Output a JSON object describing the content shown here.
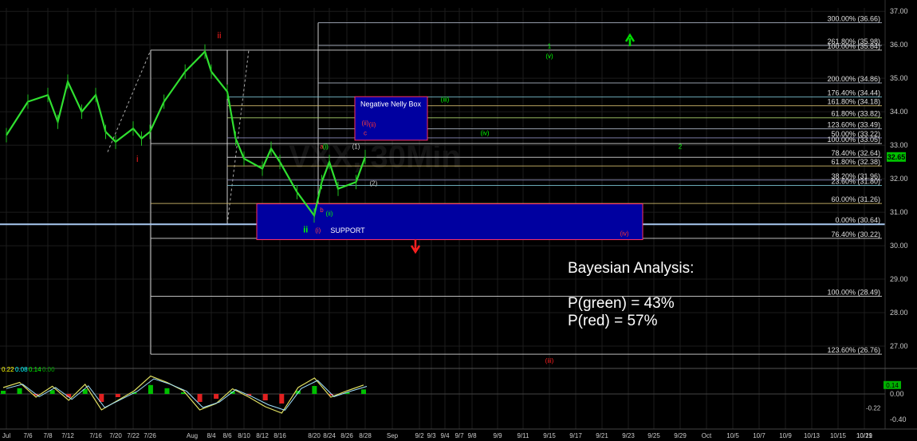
{
  "chart_data": {
    "type": "line",
    "price_axis": {
      "ticks": [
        "37.00",
        "36.00",
        "35.00",
        "34.00",
        "33.00",
        "32.00",
        "31.00",
        "30.00",
        "29.00",
        "28.00",
        "27.00"
      ],
      "current_price": "32.65",
      "ylim": [
        26.5,
        37.1
      ]
    },
    "osc_axis": {
      "ticks": [
        "0.00",
        "-0.40"
      ],
      "badges": [
        "0.14",
        "-0.22"
      ],
      "ylim": [
        -0.55,
        0.4
      ],
      "header": [
        {
          "text": "0.22",
          "color": "#ffff00"
        },
        {
          "text": "0.08",
          "color": "#00ffff"
        },
        {
          "text": "0.14",
          "color": "#00ff00"
        },
        {
          "text": "0.00",
          "color": "#00a000"
        }
      ]
    },
    "x_ticks": [
      "Jul",
      "7/6",
      "7/8",
      "7/12",
      "7/16",
      "7/20",
      "7/22",
      "7/26",
      "Aug",
      "8/4",
      "8/6",
      "8/10",
      "8/12",
      "8/16",
      "8/20",
      "8/24",
      "8/26",
      "8/28",
      "Sep",
      "9/2",
      "9/3",
      "9/4",
      "9/7",
      "9/8",
      "9/9",
      "9/11",
      "9/15",
      "9/17",
      "9/21",
      "9/23",
      "9/25",
      "9/29",
      "Oct",
      "10/5",
      "10/7",
      "10/9",
      "10/13",
      "10/15",
      "10/19",
      "10/21"
    ],
    "price_series": [
      {
        "date": "7/1",
        "price": 33.3
      },
      {
        "date": "7/6",
        "price": 34.3
      },
      {
        "date": "7/8",
        "price": 34.5
      },
      {
        "date": "7/10",
        "price": 33.7
      },
      {
        "date": "7/12",
        "price": 34.9
      },
      {
        "date": "7/14",
        "price": 34.0
      },
      {
        "date": "7/16",
        "price": 34.5
      },
      {
        "date": "7/18",
        "price": 33.4
      },
      {
        "date": "7/20",
        "price": 33.1
      },
      {
        "date": "7/22",
        "price": 33.5
      },
      {
        "date": "7/24",
        "price": 33.2
      },
      {
        "date": "7/26",
        "price": 33.4
      },
      {
        "date": "7/28",
        "price": 34.3
      },
      {
        "date": "7/31",
        "price": 35.2
      },
      {
        "date": "8/3",
        "price": 35.8
      },
      {
        "date": "8/4",
        "price": 35.2
      },
      {
        "date": "8/6",
        "price": 34.6
      },
      {
        "date": "8/8",
        "price": 33.2
      },
      {
        "date": "8/10",
        "price": 32.6
      },
      {
        "date": "8/12",
        "price": 32.3
      },
      {
        "date": "8/14",
        "price": 32.9
      },
      {
        "date": "8/16",
        "price": 32.5
      },
      {
        "date": "8/18",
        "price": 31.6
      },
      {
        "date": "8/20",
        "price": 30.9
      },
      {
        "date": "8/22",
        "price": 31.9
      },
      {
        "date": "8/24",
        "price": 32.5
      },
      {
        "date": "8/25",
        "price": 31.7
      },
      {
        "date": "8/27",
        "price": 31.9
      },
      {
        "date": "8/28",
        "price": 32.65
      }
    ],
    "fib_levels": [
      {
        "label": "300.00% (36.66)",
        "price": 36.66,
        "color": "#b0b8c8"
      },
      {
        "label": "261.80% (35.98)",
        "price": 35.98,
        "color": "#b0b8c8"
      },
      {
        "label": "100.00% (35.84)",
        "price": 35.84,
        "color": "#dddddd"
      },
      {
        "label": "200.00% (34.86)",
        "price": 34.86,
        "color": "#b0b8c8"
      },
      {
        "label": "176.40% (34.44)",
        "price": 34.44,
        "color": "#7ec8d8"
      },
      {
        "label": "161.80% (34.18)",
        "price": 34.18,
        "color": "#d8c070"
      },
      {
        "label": "61.80% (33.82)",
        "price": 33.82,
        "color": "#b0d870"
      },
      {
        "label": "123.60% (33.49)",
        "price": 33.49,
        "color": "#b0b8c8"
      },
      {
        "label": "50.00% (33.22)",
        "price": 33.22,
        "color": "#9090c0"
      },
      {
        "label": "100.00% (33.05)",
        "price": 33.05,
        "color": "#dddddd"
      },
      {
        "label": "78.40% (32.64)",
        "price": 32.64,
        "color": "#dddddd"
      },
      {
        "label": "61.80% (32.38)",
        "price": 32.38,
        "color": "#d8c070"
      },
      {
        "label": "38.20% (31.96)",
        "price": 31.96,
        "color": "#9090c0"
      },
      {
        "label": "23.60% (31.80)",
        "price": 31.8,
        "color": "#7ec8d8"
      },
      {
        "label": "60.00% (31.26)",
        "price": 31.26,
        "color": "#d8c070"
      },
      {
        "label": "0.00% (30.64)",
        "price": 30.64,
        "color": "#dddddd"
      },
      {
        "label": "76.40% (30.22)",
        "price": 30.22,
        "color": "#dddddd"
      },
      {
        "label": "100.00% (28.49)",
        "price": 28.49,
        "color": "#dddddd"
      },
      {
        "label": "123.60% (26.76)",
        "price": 26.76,
        "color": "#dddddd"
      }
    ],
    "boxes": [
      {
        "label": "Negative Nelly Box",
        "inner": "(ii)",
        "color": "#0000a0"
      },
      {
        "label": "SUPPORT",
        "inner": "(iv)",
        "color": "#0000a0"
      }
    ],
    "wave_labels": [
      {
        "text": "ii",
        "color": "#ff2020",
        "date": "8/5",
        "price": 36.2
      },
      {
        "text": "i",
        "color": "#ff2020",
        "date": "7/23",
        "price": 32.5
      },
      {
        "text": "ii",
        "color": "#00ff00",
        "date": "8/19",
        "price": 30.4
      },
      {
        "text": "(i)",
        "color": "#ff4040",
        "date": "8/21",
        "price": 30.4
      },
      {
        "text": "a",
        "color": "#ff4040",
        "date": "8/22",
        "price": 32.9
      },
      {
        "text": "(i)",
        "color": "#00ff00",
        "date": "8/23",
        "price": 32.9
      },
      {
        "text": "b",
        "color": "#ff4040",
        "date": "8/22",
        "price": 31.0
      },
      {
        "text": "(ii)",
        "color": "#00ff00",
        "date": "8/24",
        "price": 30.9
      },
      {
        "text": "(1)",
        "color": "#cccccc",
        "date": "8/27",
        "price": 32.9
      },
      {
        "text": "(2)",
        "color": "#cccccc",
        "date": "8/29",
        "price": 31.8
      },
      {
        "text": "(ii)",
        "color": "#ff4040",
        "date": "8/28",
        "price": 33.6
      },
      {
        "text": "c",
        "color": "#ff4040",
        "date": "8/28",
        "price": 33.3
      },
      {
        "text": "(iii)",
        "color": "#00ff00",
        "date": "9/7",
        "price": 34.3
      },
      {
        "text": "(iv)",
        "color": "#00ff00",
        "date": "9/10",
        "price": 33.3
      },
      {
        "text": "1",
        "color": "#00ff00",
        "date": "9/17",
        "price": 35.9
      },
      {
        "text": "(v)",
        "color": "#00ff00",
        "date": "9/17",
        "price": 35.6
      },
      {
        "text": "2",
        "color": "#00ff00",
        "date": "10/1",
        "price": 32.9
      },
      {
        "text": "(iii)",
        "color": "#ff2020",
        "date": "9/17",
        "price": 26.5
      }
    ],
    "annotation": {
      "title": "Bayesian Analysis:",
      "line1": "P(green) = 43%",
      "line2": "P(red) = 57%"
    },
    "watermark": "VXX, 30Min"
  }
}
